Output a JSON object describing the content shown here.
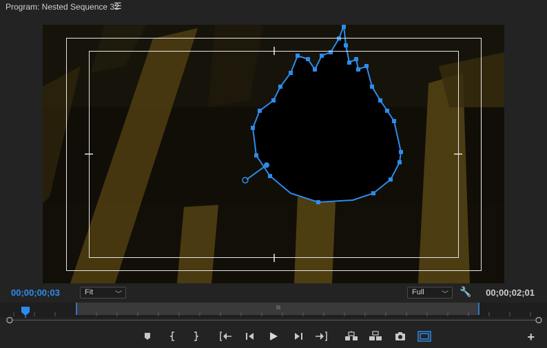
{
  "panel": {
    "title": "Program: Nested Sequence 32",
    "menu_icon": "hamburger-menu-icon"
  },
  "viewer": {
    "content": "dark video frame with golden diagonal bars, blue bezier mask path",
    "mask_color": "#2d8ceb",
    "safe_margin_color": "#e8e8e8"
  },
  "timecode": {
    "current": "00;00;00;03",
    "duration": "00;00;02;01",
    "current_color": "#2d8ceb"
  },
  "zoom": {
    "selected": "Fit"
  },
  "quality": {
    "selected": "Full"
  },
  "settings_icon": "wrench-icon",
  "controls": [
    {
      "name": "add-marker-button",
      "icon": "marker-icon"
    },
    {
      "name": "mark-in-button",
      "icon": "mark-in-icon"
    },
    {
      "name": "mark-out-button",
      "icon": "mark-out-icon"
    },
    {
      "name": "go-to-in-button",
      "icon": "go-to-in-icon"
    },
    {
      "name": "step-back-button",
      "icon": "step-back-icon"
    },
    {
      "name": "play-button",
      "icon": "play-icon"
    },
    {
      "name": "step-forward-button",
      "icon": "step-forward-icon"
    },
    {
      "name": "go-to-out-button",
      "icon": "go-to-out-icon"
    },
    {
      "name": "lift-button",
      "icon": "lift-icon"
    },
    {
      "name": "extract-button",
      "icon": "extract-icon"
    },
    {
      "name": "export-frame-button",
      "icon": "camera-icon"
    },
    {
      "name": "safe-margins-button",
      "icon": "safe-margins-icon"
    }
  ],
  "add_button_label": "+"
}
